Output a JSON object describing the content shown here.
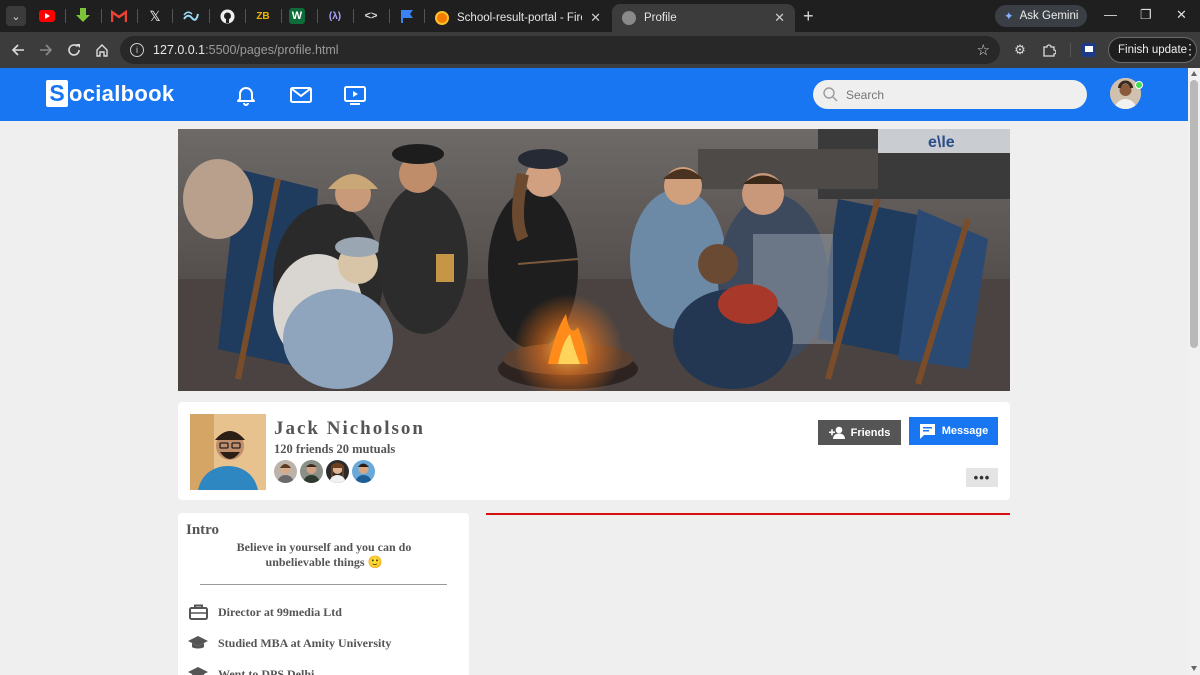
{
  "browser": {
    "tabs": [
      {
        "title": "School-result-portal - Firebase",
        "active": false
      },
      {
        "title": "Profile",
        "active": true
      }
    ],
    "gemini_label": "Ask Gemini",
    "url_host": "127.0.0.1",
    "url_path": ":5500/pages/profile.html",
    "finish_update_label": "Finish update",
    "colors": {
      "chrome_bg": "#1f1f1f",
      "toolbar_bg": "#3c3c3c"
    }
  },
  "app": {
    "brand_letter": "S",
    "brand_rest": "ocialbook",
    "search_placeholder": "Search",
    "colors": {
      "primary": "#1876f2",
      "page_bg": "#efefef",
      "online": "#41db51",
      "accent_line": "#d60f0f"
    }
  },
  "profile": {
    "name": "Jack Nicholson",
    "friends_text": "120 friends 20 mutuals",
    "mutual_thumb_count": 4,
    "friends_button": "Friends",
    "message_button": "Message",
    "more_button": "•••"
  },
  "intro": {
    "title": "Intro",
    "quote": "Believe in yourself and you can do unbelievable things 🙂",
    "items": [
      {
        "icon": "briefcase-icon",
        "text": "Director at 99media Ltd"
      },
      {
        "icon": "graduation-cap-icon",
        "text": "Studied MBA at Amity University"
      },
      {
        "icon": "graduation-cap-icon",
        "text": "Went to DPS Delhi"
      }
    ]
  }
}
